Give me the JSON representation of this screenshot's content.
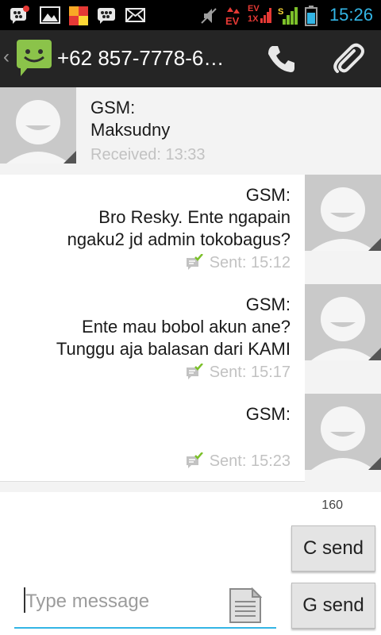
{
  "status_bar": {
    "time": "15:26",
    "ev_label": "EV",
    "evdo_label_top": "EV",
    "evdo_label_bottom": "1X",
    "icons": [
      "bbm-notification-icon",
      "gallery-icon",
      "tiles-app-icon",
      "bbm-icon",
      "email-icon",
      "mute-icon",
      "data-transfer-icon",
      "evdo-signal-icon",
      "gsm-signal-icon",
      "battery-icon"
    ]
  },
  "action_bar": {
    "title": "+62 857-7778-6…",
    "icons": [
      "back-chevron-icon",
      "messaging-app-icon",
      "phone-icon",
      "paperclip-icon"
    ]
  },
  "messages": [
    {
      "type": "received",
      "lines": "GSM:\nMaksudny",
      "meta": "Received: 13:33"
    },
    {
      "type": "sent",
      "lines": "GSM:\nBro Resky. Ente ngapain\nngaku2 jd admin tokobagus?",
      "meta": "Sent: 15:12"
    },
    {
      "type": "sent",
      "lines": "GSM:\nEnte mau bobol akun ane?\nTunggu aja balasan dari KAMI",
      "meta": "Sent: 15:17"
    },
    {
      "type": "sent",
      "lines": "GSM:",
      "meta": "Sent: 15:23"
    }
  ],
  "compose": {
    "char_count": "160",
    "placeholder": "Type message",
    "send_c_label": "C send",
    "send_g_label": "G send"
  },
  "colors": {
    "accent": "#33b5e5",
    "action_bar": "#252525",
    "sent_check": "#7cc02a"
  }
}
